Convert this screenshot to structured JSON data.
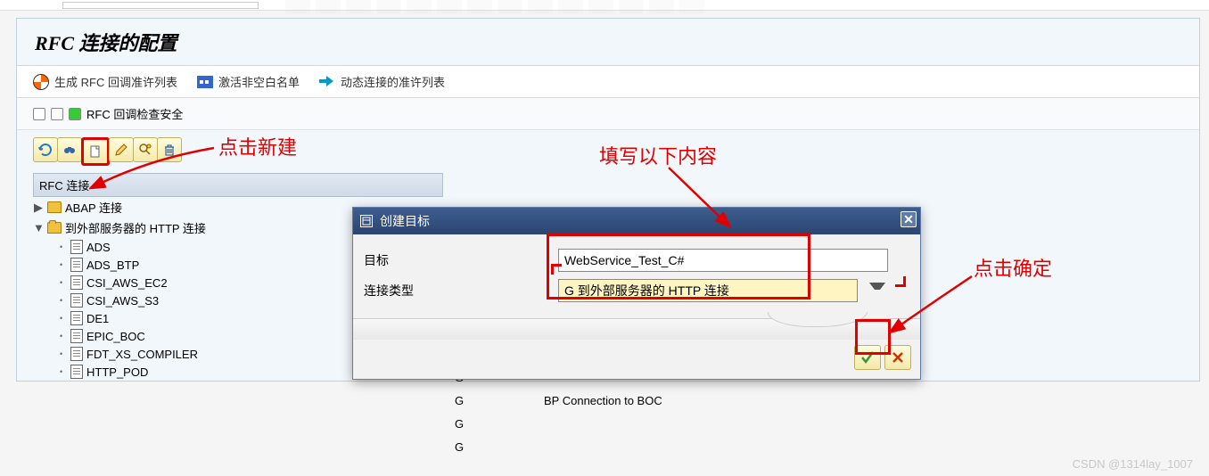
{
  "title": "RFC 连接的配置",
  "actions": {
    "callback_list": "生成 RFC 回调准许列表",
    "whitelist": "激活非空白名单",
    "dynamic_list": "动态连接的准许列表"
  },
  "status_label": "RFC 回调检查安全",
  "tree_header": "RFC 连接",
  "tree": {
    "abap": "ABAP 连接",
    "http_ext": "到外部服务器的 HTTP 连接",
    "leaves": [
      "ADS",
      "ADS_BTP",
      "CSI_AWS_EC2",
      "CSI_AWS_S3",
      "DE1",
      "EPIC_BOC",
      "FDT_XS_COMPILER",
      "HTTP_POD"
    ]
  },
  "grid": {
    "g": "G",
    "rows": [
      "G",
      "G",
      "G",
      "G"
    ],
    "desc": [
      "",
      "BP Connection to BOC",
      "",
      ""
    ]
  },
  "dialog": {
    "title": "创建目标",
    "label_dest": "目标",
    "label_type": "连接类型",
    "value_dest": "WebService_Test_C#",
    "value_type": "G 到外部服务器的 HTTP 连接"
  },
  "annotations": {
    "new": "点击新建",
    "fill": "填写以下内容",
    "ok": "点击确定"
  },
  "watermark": "CSDN @1314lay_1007"
}
